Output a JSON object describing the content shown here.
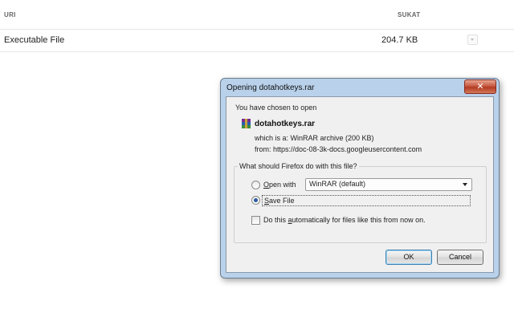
{
  "table": {
    "col_name": "URI",
    "col_size": "SUKAT",
    "rows": [
      {
        "name": "Executable File",
        "size": "204.7  KB"
      }
    ]
  },
  "dialog": {
    "title": "Opening dotahotkeys.rar",
    "close_glyph": "✕",
    "intro": "You have chosen to open",
    "file_name": "dotahotkeys.rar",
    "which_is": "which is a:  WinRAR archive (200 KB)",
    "from": "from:  https://doc-08-3k-docs.googleusercontent.com",
    "question": "What should Firefox do with this file?",
    "open_with_label_u": "O",
    "open_with_label_rest": "pen with",
    "open_with_app": "WinRAR (default)",
    "save_file_label_u": "S",
    "save_file_label_rest": "ave File",
    "auto_label_pre": "Do this ",
    "auto_label_u": "a",
    "auto_label_rest": "utomatically for files like this from now on.",
    "ok_label": "OK",
    "cancel_label": "Cancel",
    "selected_action": "save_file",
    "auto_checked": false
  },
  "icons": {
    "file_icon": "winrar-archive-icon",
    "menu_icon": "chevron-down-icon"
  },
  "colors": {
    "dialog_frame": "#b9d1ea",
    "close_button": "#c75a43",
    "radio_selected": "#2d5aa0"
  }
}
